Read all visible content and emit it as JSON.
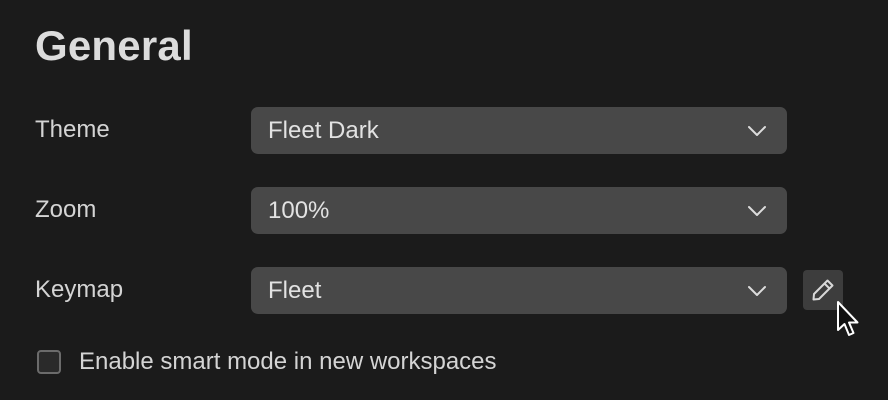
{
  "section": {
    "title": "General"
  },
  "settings": {
    "theme": {
      "label": "Theme",
      "value": "Fleet Dark"
    },
    "zoom": {
      "label": "Zoom",
      "value": "100%"
    },
    "keymap": {
      "label": "Keymap",
      "value": "Fleet"
    }
  },
  "options": {
    "smart_mode": {
      "label": "Enable smart mode in new workspaces",
      "checked": false
    }
  },
  "icons": {
    "dropdown": "chevron-down-icon",
    "edit": "pencil-icon",
    "cursor": "mouse-pointer"
  },
  "colors": {
    "background": "#1b1b1b",
    "select_bg": "#484848",
    "text": "#d9d9d9"
  }
}
